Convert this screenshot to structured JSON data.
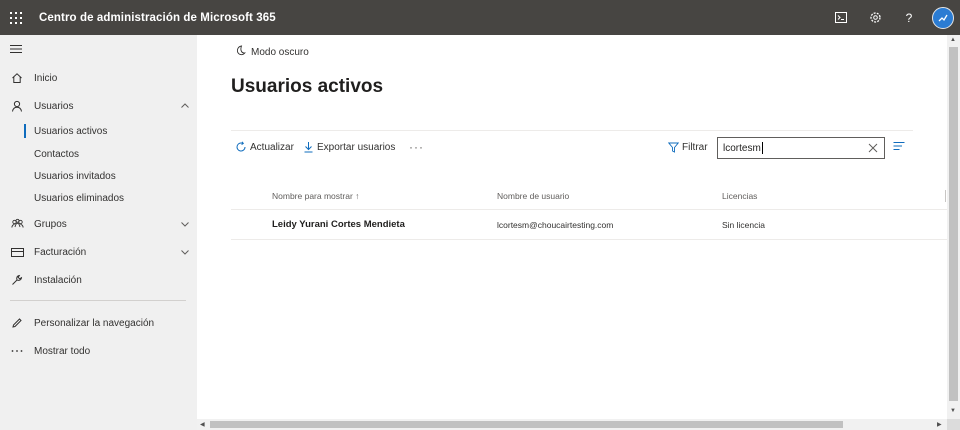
{
  "app": {
    "title": "Centro de administración de Microsoft 365",
    "topbar_icons": [
      "terminal-icon",
      "gear-icon",
      "help-icon",
      "avatar"
    ],
    "help_glyph": "?"
  },
  "sidebar": {
    "items": [
      {
        "label": "Inicio",
        "icon": "home-icon"
      },
      {
        "label": "Usuarios",
        "icon": "person-icon",
        "expanded": true
      },
      {
        "label": "Grupos",
        "icon": "group-icon",
        "expanded": false
      },
      {
        "label": "Facturación",
        "icon": "billing-icon",
        "expanded": false
      },
      {
        "label": "Instalación",
        "icon": "wrench-icon"
      },
      {
        "label": "Personalizar la navegación",
        "icon": "pencil-icon"
      },
      {
        "label": "Mostrar todo",
        "icon": "ellipsis-icon"
      }
    ],
    "subitems": [
      {
        "label": "Usuarios activos",
        "active": true
      },
      {
        "label": "Contactos"
      },
      {
        "label": "Usuarios invitados"
      },
      {
        "label": "Usuarios eliminados"
      }
    ]
  },
  "main": {
    "darkmode_label": "Modo oscuro",
    "title": "Usuarios activos",
    "commands": {
      "refresh": "Actualizar",
      "export": "Exportar usuarios",
      "more": "···",
      "filter": "Filtrar"
    },
    "search": {
      "value": "lcortesm"
    },
    "table": {
      "columns": [
        "Nombre para mostrar ↑",
        "Nombre de usuario",
        "Licencias"
      ],
      "rows": [
        {
          "name": "Leidy Yurani Cortes Mendieta",
          "username": "lcortesm@choucairtesting.com",
          "license": "Sin licencia"
        }
      ]
    }
  },
  "colors": {
    "topbar": "#474542",
    "sidebar": "#f0f0f0",
    "accent": "#0f6cbd"
  }
}
